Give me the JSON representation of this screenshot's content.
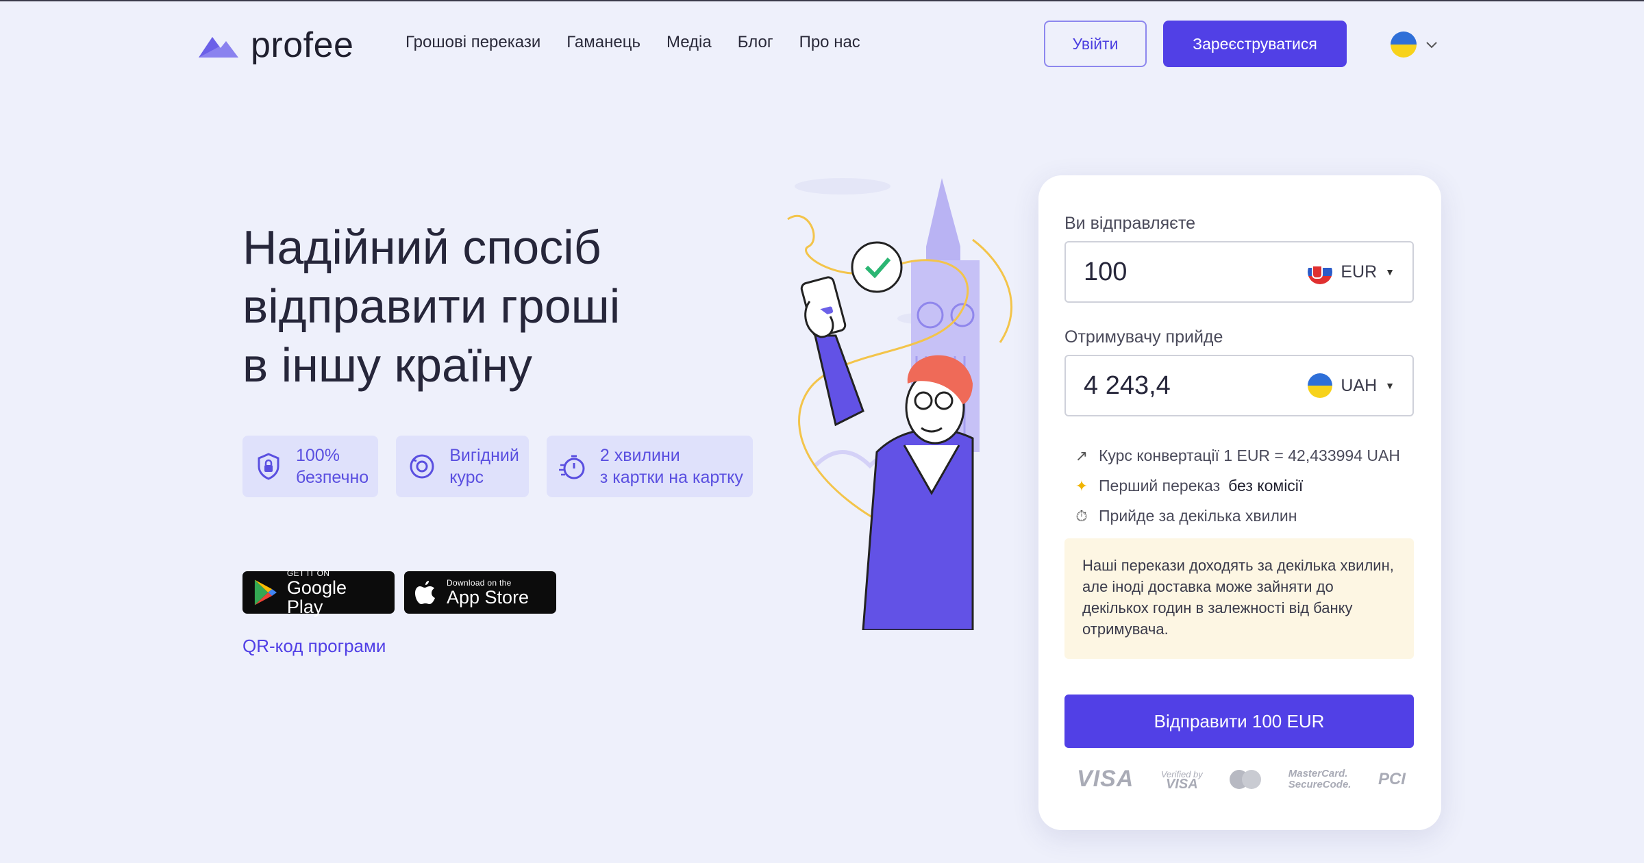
{
  "header": {
    "logo_text": "profee",
    "nav": [
      "Грошові перекази",
      "Гаманець",
      "Медіа",
      "Блог",
      "Про нас"
    ],
    "login_label": "Увійти",
    "register_label": "Зареєструватися",
    "language_icon": "flag-ua-icon"
  },
  "hero": {
    "title_lines": [
      "Надійний спосіб",
      "відправити гроші",
      "в іншу країну"
    ],
    "features": [
      {
        "icon": "shield-lock-icon",
        "line1": "100%",
        "line2": "безпечно"
      },
      {
        "icon": "rate-circle-icon",
        "line1": "Вигідний",
        "line2": "курс"
      },
      {
        "icon": "timer-icon",
        "line1": "2 хвилини",
        "line2": "з картки на картку"
      }
    ],
    "google_play": {
      "small": "GET IT ON",
      "big": "Google Play"
    },
    "app_store": {
      "small": "Download on the",
      "big": "App Store"
    },
    "qr_link": "QR-код програми"
  },
  "calculator": {
    "send_label": "Ви відправляєте",
    "send_value": "100",
    "send_currency": "EUR",
    "receive_label": "Отримувачу прийде",
    "receive_value": "4 243,4",
    "receive_currency": "UAH",
    "rate_text": "Курс конвертації 1 EUR = 42,433994 UAH",
    "first_transfer_text": "Перший переказ",
    "first_transfer_bold": "без комісії",
    "arrival_text": "Прийде за декілька хвилин",
    "notice": "Наші перекази доходять за декілька хвилин, але іноді доставка може зайняти до декількох годин в залежності від банку отримувача.",
    "send_button": "Відправити 100 EUR",
    "payment_logos": {
      "visa": "VISA",
      "vbv_top": "Verified by",
      "vbv_bottom": "VISA",
      "mastercard_1": "MasterCard.",
      "mastercard_2": "SecureCode.",
      "pci": "PCI"
    }
  },
  "colors": {
    "brand": "#5140e6",
    "background": "#eef0fb",
    "feature_bg": "#dfe1fb",
    "notice_bg": "#fdf6e3"
  }
}
